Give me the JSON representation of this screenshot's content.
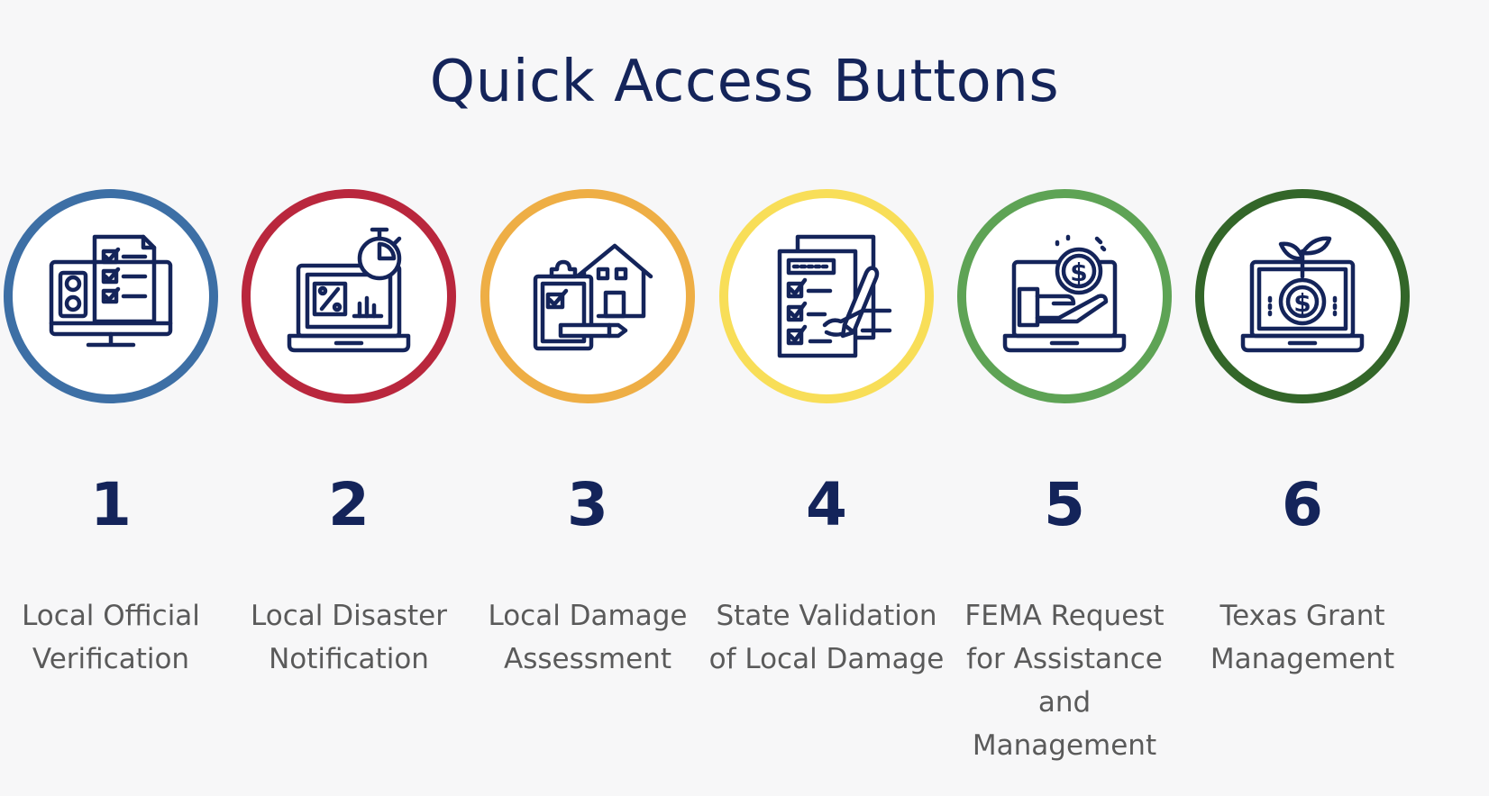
{
  "title": "Quick Access Buttons",
  "steps": [
    {
      "number": "1",
      "label": "Local Official Verification",
      "color": "#3d6fa5",
      "icon": "monitor-checklist-icon"
    },
    {
      "number": "2",
      "label": "Local Disaster Notification",
      "color": "#b9273d",
      "icon": "laptop-stopwatch-icon"
    },
    {
      "number": "3",
      "label": "Local Damage Assessment",
      "color": "#eeae45",
      "icon": "house-clipboard-icon"
    },
    {
      "number": "4",
      "label": "State Validation of Local Damage",
      "color": "#f8de58",
      "icon": "document-signing-icon"
    },
    {
      "number": "5",
      "label": "FEMA Request for Assistance and Management",
      "color": "#5ea355",
      "icon": "hand-coin-laptop-icon"
    },
    {
      "number": "6",
      "label": "Texas Grant Management",
      "color": "#336629",
      "icon": "laptop-coin-plant-icon"
    }
  ]
}
